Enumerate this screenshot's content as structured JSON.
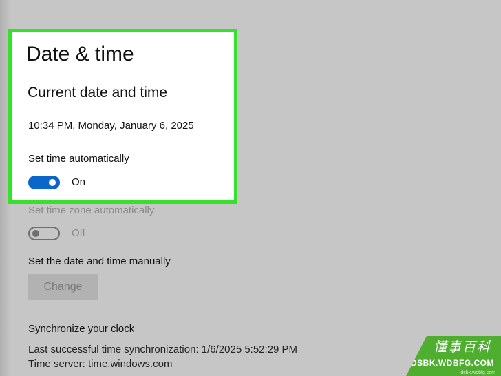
{
  "page": {
    "title": "Date & time"
  },
  "current": {
    "heading": "Current date and time",
    "datetime": "10:34 PM, Monday, January 6, 2025"
  },
  "auto_time": {
    "label": "Set time automatically",
    "state": "On",
    "enabled": true
  },
  "auto_timezone": {
    "label": "Set time zone automatically",
    "state": "Off",
    "enabled": false
  },
  "manual": {
    "label": "Set the date and time manually",
    "button_label": "Change"
  },
  "sync": {
    "heading": "Synchronize your clock",
    "last_sync": "Last successful time synchronization: 1/6/2025 5:52:29 PM",
    "server": "Time server: time.windows.com"
  },
  "watermark": {
    "cn": "懂事百科",
    "en": "DSBK.WDBFG.COM",
    "small": "dsbk.wdbfg.com"
  },
  "colors": {
    "highlight_border": "#35e12a",
    "toggle_on": "#0a66c8",
    "watermark_bg": "#4fae2f"
  }
}
